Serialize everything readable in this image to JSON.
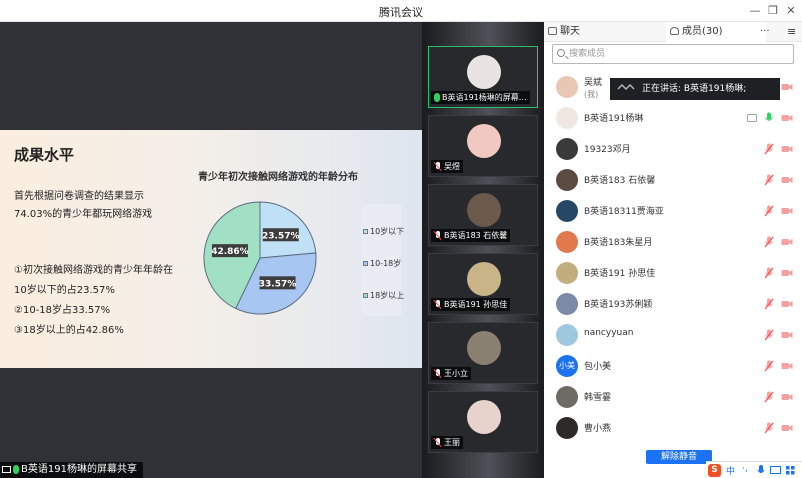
{
  "window": {
    "title": "腾讯会议"
  },
  "slide": {
    "title": "成果水平",
    "intro_line1": "首先根据问卷调查的结果显示",
    "intro_line2": "74.03%的青少年都玩网络游戏",
    "points": [
      "①初次接触网络游戏的青少年年龄在",
      "10岁以下的占23.57%",
      "②10-18岁占33.57%",
      "③18岁以上的占42.86%"
    ]
  },
  "chart_data": {
    "type": "pie",
    "title": "青少年初次接触网络游戏的年龄分布",
    "categories": [
      "10岁以下",
      "10-18岁",
      "18岁以上"
    ],
    "values": [
      23.57,
      33.57,
      42.86
    ],
    "value_labels": [
      "23.57%",
      "33.57%",
      "42.86%"
    ],
    "colors": [
      "#bfe0f5",
      "#a8c6f2",
      "#a2e0c6"
    ],
    "legend_position": "right"
  },
  "share_label": "B英语191杨琳的屏幕共享",
  "thumbnails": [
    {
      "label": "B英语191杨琳的屏幕…",
      "active": true,
      "avatar_color": "#e9e4e2"
    },
    {
      "label": "吴煜",
      "active": false,
      "avatar_color": "#f2c9c2"
    },
    {
      "label": "B英语183 石依馨",
      "active": false,
      "avatar_color": "#6b5a4c"
    },
    {
      "label": "B英语191 孙思佳",
      "active": false,
      "avatar_color": "#c9b487"
    },
    {
      "label": "王小立",
      "active": false,
      "avatar_color": "#8a8072"
    },
    {
      "label": "王丽",
      "active": false,
      "avatar_color": "#e7d3cc"
    }
  ],
  "panel": {
    "tab_chat": "聊天",
    "tab_members": "成员(30)",
    "more": "···",
    "search_placeholder": "搜索成员",
    "speaking": "正在讲话: B英语191杨琳;",
    "unmute_all": "解除静音"
  },
  "members": [
    {
      "name": "吴斌",
      "sub": "(我)",
      "avatar_color": "#e8c8b4",
      "mic": "muted",
      "cam": "off",
      "screen": false
    },
    {
      "name": "B英语191杨琳",
      "sub": "",
      "avatar_color": "#f0e6e2",
      "mic": "on",
      "cam": "off",
      "screen": true
    },
    {
      "name": "19323邓月",
      "sub": "",
      "avatar_color": "#3b3a3a",
      "mic": "muted",
      "cam": "off",
      "screen": false
    },
    {
      "name": "B英语183 石依馨",
      "sub": "",
      "avatar_color": "#5b4a40",
      "mic": "muted",
      "cam": "off",
      "screen": false
    },
    {
      "name": "B英语18311贾海亚",
      "sub": "",
      "avatar_color": "#264866",
      "mic": "muted",
      "cam": "off",
      "screen": false
    },
    {
      "name": "B英语183朱星月",
      "sub": "",
      "avatar_color": "#e07a4c",
      "mic": "muted",
      "cam": "off",
      "screen": false
    },
    {
      "name": "B英语191 孙思佳",
      "sub": "",
      "avatar_color": "#c2ad7e",
      "mic": "muted",
      "cam": "off",
      "screen": false
    },
    {
      "name": "B英语193苏俐颖",
      "sub": "",
      "avatar_color": "#7c8aa6",
      "mic": "muted",
      "cam": "off",
      "screen": false
    },
    {
      "name": "nancyyuan",
      "sub": "",
      "avatar_color": "#9fc7dd",
      "mic": "muted",
      "cam": "off",
      "screen": false
    },
    {
      "name": "包小美",
      "sub": "",
      "avatar_color": "#1b72f2",
      "avatar_text": "小美",
      "mic": "muted",
      "cam": "off",
      "screen": false
    },
    {
      "name": "韩雪霎",
      "sub": "",
      "avatar_color": "#6e6a66",
      "mic": "muted",
      "cam": "off",
      "screen": false
    },
    {
      "name": "曹小燕",
      "sub": "",
      "avatar_color": "#2e2a28",
      "mic": "muted",
      "cam": "off",
      "screen": false
    }
  ],
  "ime": {
    "logo": "S",
    "lang": "中",
    "punct": "·,",
    "voice": "mic-icon",
    "keyboard": "keyboard-icon",
    "grid": "grid-icon"
  },
  "colors": {
    "accent": "#1b72f2",
    "active_border": "#2fbf6a",
    "mute_red": "#ff4d4f"
  }
}
